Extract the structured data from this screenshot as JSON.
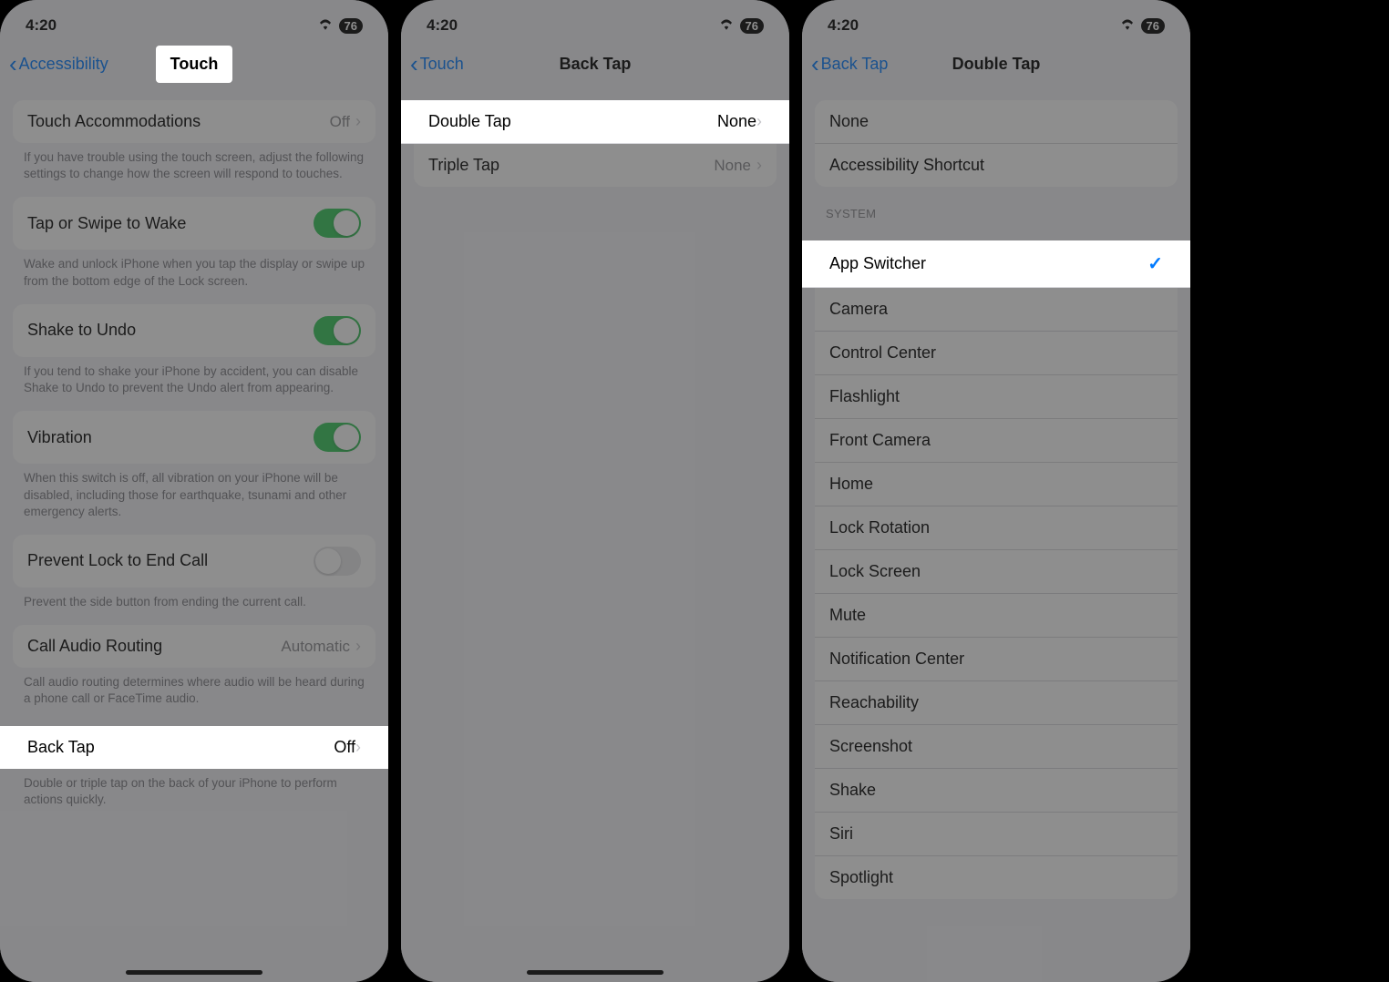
{
  "status": {
    "time": "4:20",
    "battery": "76"
  },
  "screen1": {
    "back": "Accessibility",
    "title": "Touch",
    "touchAccommodations": {
      "label": "Touch Accommodations",
      "value": "Off"
    },
    "touchAccommodationsFooter": "If you have trouble using the touch screen, adjust the following settings to change how the screen will respond to touches.",
    "tapWake": {
      "label": "Tap or Swipe to Wake",
      "on": true
    },
    "tapWakeFooter": "Wake and unlock iPhone when you tap the display or swipe up from the bottom edge of the Lock screen.",
    "shakeUndo": {
      "label": "Shake to Undo",
      "on": true
    },
    "shakeUndoFooter": "If you tend to shake your iPhone by accident, you can disable Shake to Undo to prevent the Undo alert from appearing.",
    "vibration": {
      "label": "Vibration",
      "on": true
    },
    "vibrationFooter": "When this switch is off, all vibration on your iPhone will be disabled, including those for earthquake, tsunami and other emergency alerts.",
    "preventLock": {
      "label": "Prevent Lock to End Call",
      "on": false
    },
    "preventLockFooter": "Prevent the side button from ending the current call.",
    "callAudio": {
      "label": "Call Audio Routing",
      "value": "Automatic"
    },
    "callAudioFooter": "Call audio routing determines where audio will be heard during a phone call or FaceTime audio.",
    "backTap": {
      "label": "Back Tap",
      "value": "Off"
    },
    "backTapFooter": "Double or triple tap on the back of your iPhone to perform actions quickly."
  },
  "screen2": {
    "back": "Touch",
    "title": "Back Tap",
    "doubleTap": {
      "label": "Double Tap",
      "value": "None"
    },
    "tripleTap": {
      "label": "Triple Tap",
      "value": "None"
    }
  },
  "screen3": {
    "back": "Back Tap",
    "title": "Double Tap",
    "topItems": [
      "None",
      "Accessibility Shortcut"
    ],
    "systemHeader": "SYSTEM",
    "systemItems": [
      "App Switcher",
      "Camera",
      "Control Center",
      "Flashlight",
      "Front Camera",
      "Home",
      "Lock Rotation",
      "Lock Screen",
      "Mute",
      "Notification Center",
      "Reachability",
      "Screenshot",
      "Shake",
      "Siri",
      "Spotlight"
    ],
    "selected": "App Switcher"
  }
}
